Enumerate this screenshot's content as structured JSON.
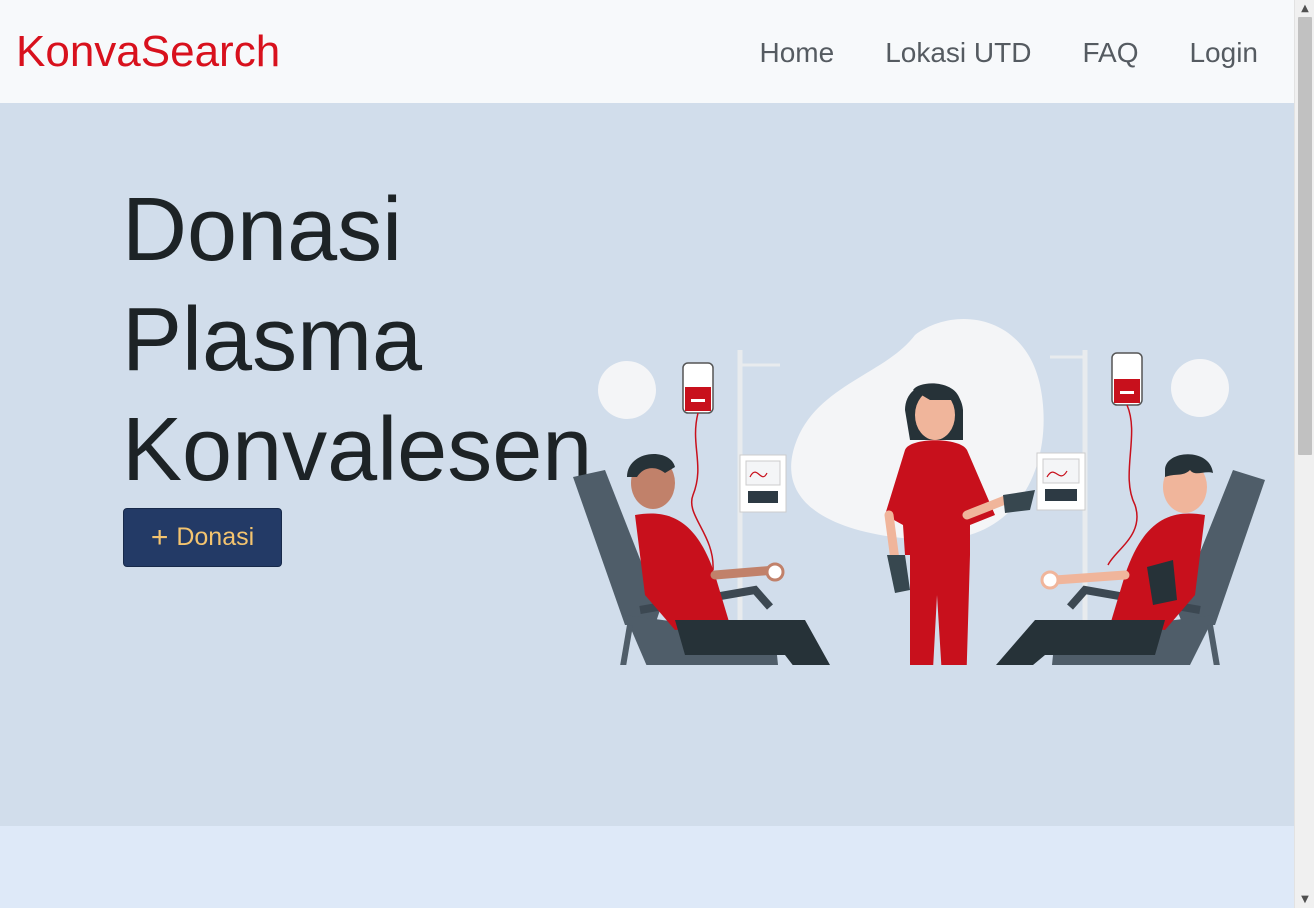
{
  "navbar": {
    "brand": "KonvaSearch",
    "links": [
      "Home",
      "Lokasi UTD",
      "FAQ",
      "Login"
    ]
  },
  "hero": {
    "title_lines": [
      "Donasi",
      "Plasma",
      "Konvalesen"
    ],
    "button_icon": "+",
    "button_label": "Donasi",
    "illustration": "blood-donation-illustration"
  },
  "colors": {
    "brand": "#d8111d",
    "hero_bg": "#d1ddeb",
    "button_bg": "#233a66",
    "button_text": "#f4c46f",
    "accent_red": "#c8101c"
  },
  "scrollbar": {
    "up_icon": "scroll-up-arrow-icon",
    "down_icon": "scroll-down-arrow-icon"
  }
}
